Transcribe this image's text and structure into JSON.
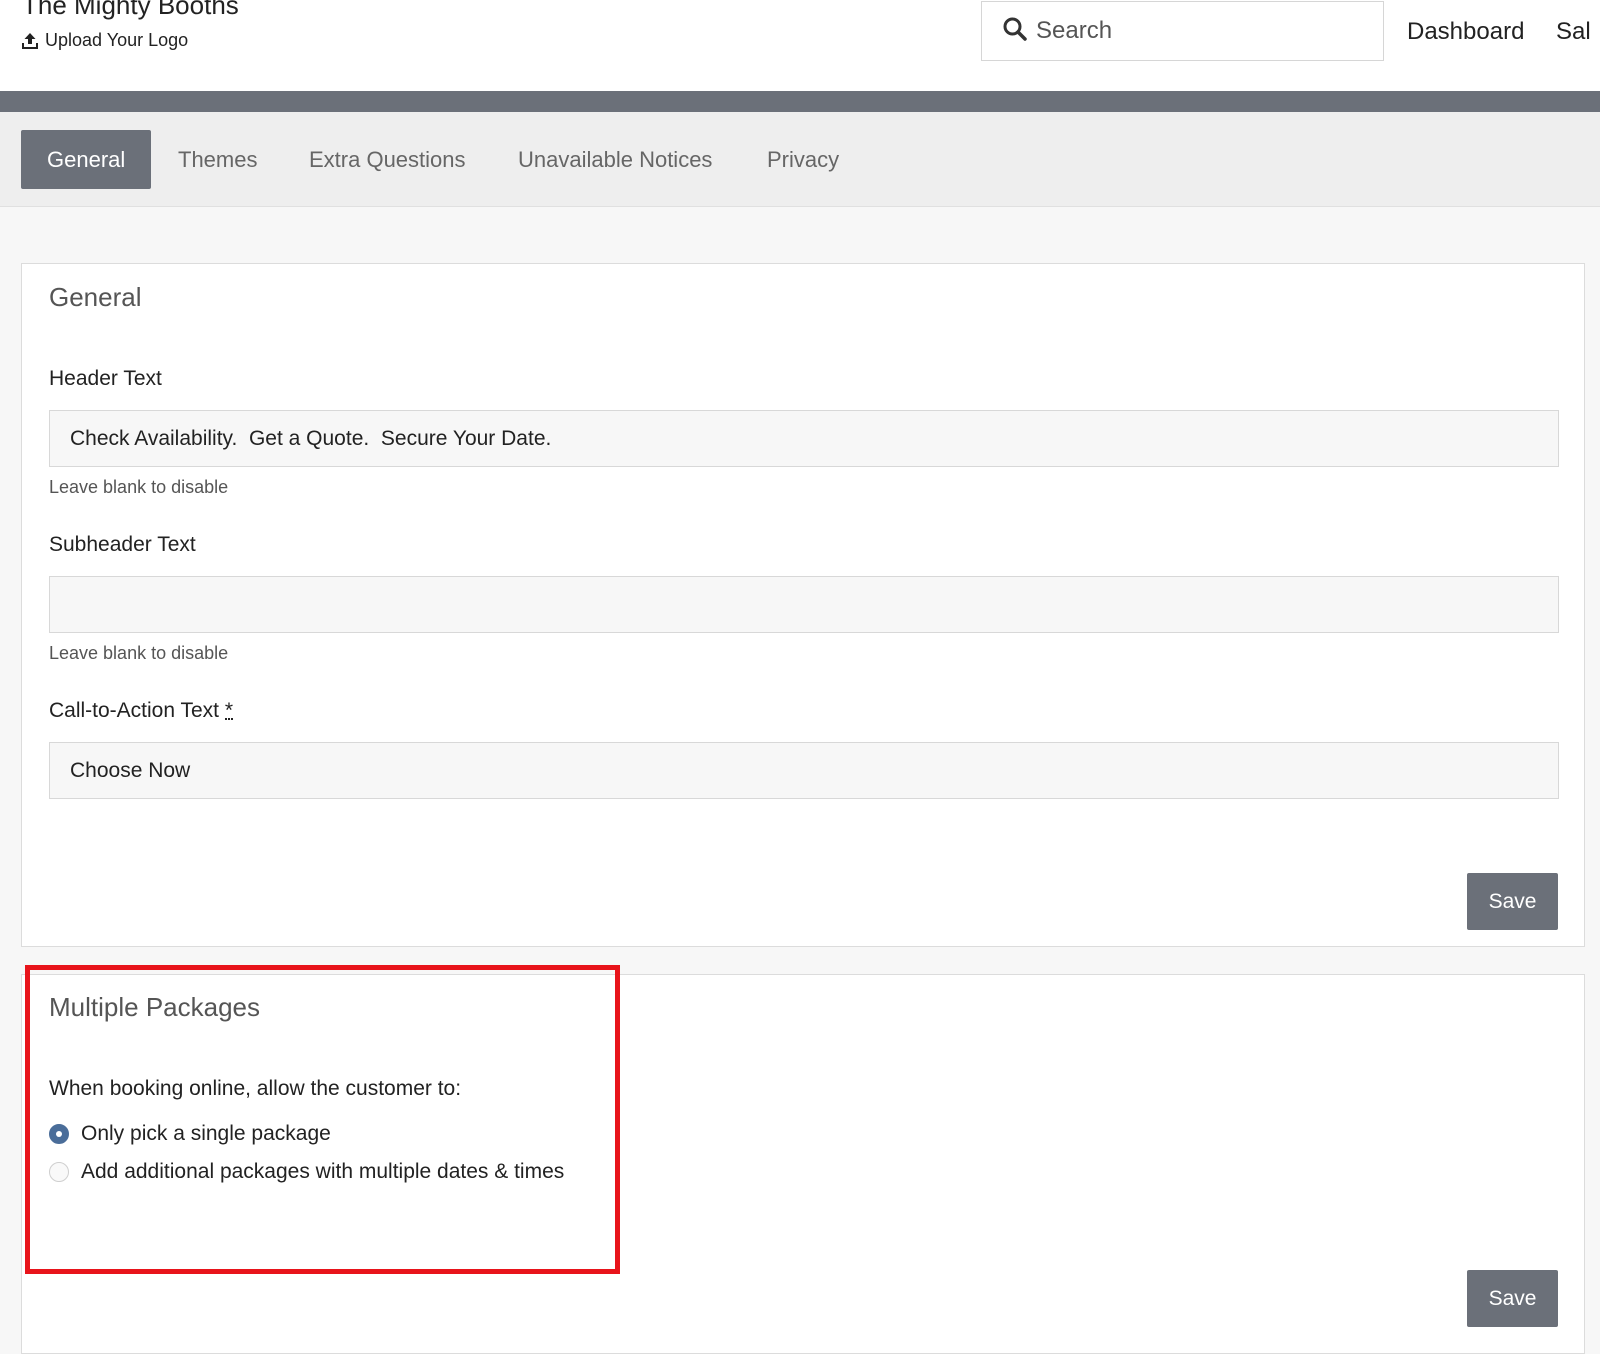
{
  "header": {
    "brand": "The Mighty Booths",
    "upload_logo": "Upload Your Logo",
    "search_placeholder": "Search",
    "nav": [
      "Dashboard",
      "Sal"
    ]
  },
  "tabs": [
    {
      "label": "General",
      "active": true
    },
    {
      "label": "Themes",
      "active": false
    },
    {
      "label": "Extra Questions",
      "active": false
    },
    {
      "label": "Unavailable Notices",
      "active": false
    },
    {
      "label": "Privacy",
      "active": false
    }
  ],
  "general_panel": {
    "title": "General",
    "header_text": {
      "label": "Header Text",
      "value": "Check Availability.  Get a Quote.  Secure Your Date.",
      "help": "Leave blank to disable"
    },
    "subheader_text": {
      "label": "Subheader Text",
      "value": "",
      "help": "Leave blank to disable"
    },
    "cta_text": {
      "label": "Call-to-Action Text",
      "required_mark": "*",
      "value": "Choose Now"
    },
    "save_label": "Save"
  },
  "packages_panel": {
    "title": "Multiple Packages",
    "prompt": "When booking online, allow the customer to:",
    "options": [
      {
        "label": "Only pick a single package",
        "selected": true
      },
      {
        "label": "Add additional packages with multiple dates & times",
        "selected": false
      }
    ],
    "save_label": "Save"
  },
  "colors": {
    "accent": "#6b7079",
    "radio_selected": "#4a6d99",
    "highlight": "#e8141b"
  }
}
